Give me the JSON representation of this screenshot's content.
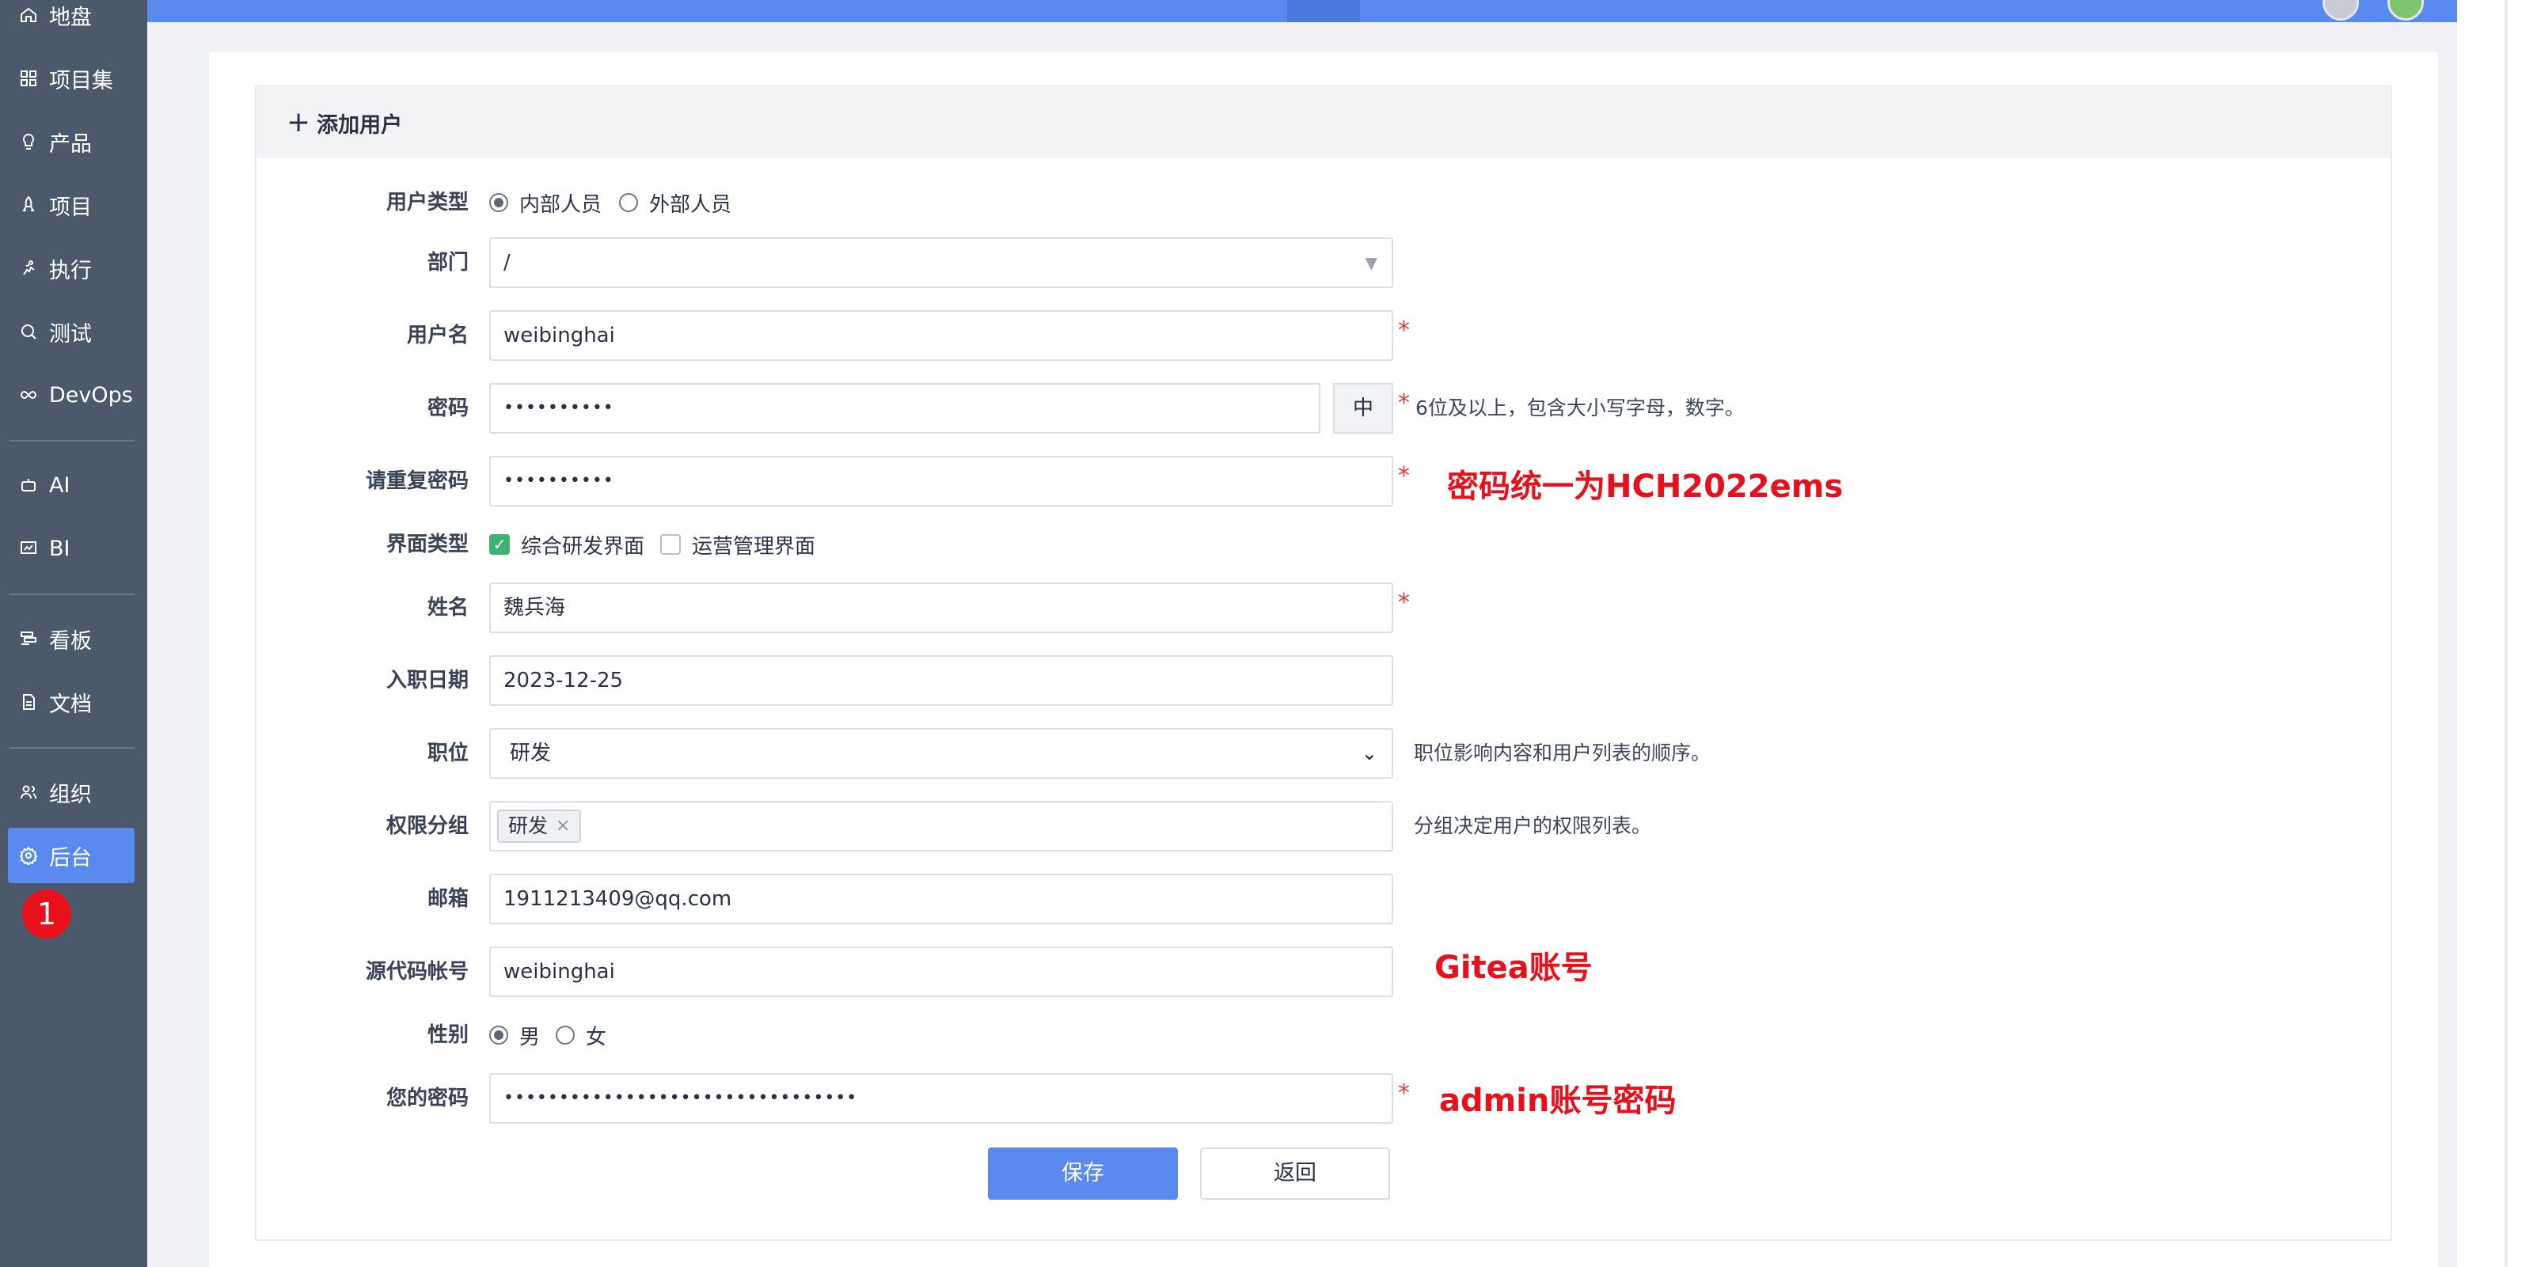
{
  "sidebar": {
    "items": [
      {
        "label": "地盘",
        "icon": "home-icon"
      },
      {
        "label": "项目集",
        "icon": "grid-icon"
      },
      {
        "label": "产品",
        "icon": "bulb-icon"
      },
      {
        "label": "项目",
        "icon": "rocket-icon"
      },
      {
        "label": "执行",
        "icon": "run-icon"
      },
      {
        "label": "测试",
        "icon": "search-icon"
      },
      {
        "label": "DevOps",
        "icon": "infinity-icon"
      },
      {
        "label": "AI",
        "icon": "robot-icon"
      },
      {
        "label": "BI",
        "icon": "chart-icon"
      },
      {
        "label": "看板",
        "icon": "board-icon"
      },
      {
        "label": "文档",
        "icon": "doc-icon"
      },
      {
        "label": "组织",
        "icon": "users-icon"
      },
      {
        "label": "后台",
        "icon": "gear-icon"
      }
    ],
    "active_item": "后台",
    "step_badge": "1"
  },
  "card": {
    "title": "添加用户",
    "title_icon": "plus-icon"
  },
  "form": {
    "user_type": {
      "label": "用户类型",
      "options": [
        "内部人员",
        "外部人员"
      ],
      "selected": "内部人员"
    },
    "dept": {
      "label": "部门",
      "value": "/"
    },
    "account": {
      "label": "用户名",
      "value": "weibinghai"
    },
    "password": {
      "label": "密码",
      "value": "••••••••••",
      "strength": "中",
      "hint": "6位及以上，包含大小写字母，数字。"
    },
    "password_repeat": {
      "label": "请重复密码",
      "value": "••••••••••"
    },
    "visions": {
      "label": "界面类型",
      "options": [
        "综合研发界面",
        "运营管理界面"
      ],
      "checked": [
        "综合研发界面"
      ]
    },
    "realname": {
      "label": "姓名",
      "value": "魏兵海"
    },
    "join_date": {
      "label": "入职日期",
      "value": "2023-12-25"
    },
    "role": {
      "label": "职位",
      "value": "研发",
      "hint": "职位影响内容和用户列表的顺序。"
    },
    "group": {
      "label": "权限分组",
      "tags": [
        "研发"
      ],
      "hint": "分组决定用户的权限列表。"
    },
    "email": {
      "label": "邮箱",
      "value": "1911213409@qq.com"
    },
    "commiter": {
      "label": "源代码帐号",
      "value": "weibinghai"
    },
    "gender": {
      "label": "性别",
      "options": [
        "男",
        "女"
      ],
      "selected": "男"
    },
    "verify_password": {
      "label": "您的密码",
      "value": "••••••••••••••••••••••••••••••••"
    }
  },
  "required_mark": "*",
  "annotations": {
    "password_note": "密码统一为HCH2022ems",
    "gitea_note": "Gitea账号",
    "admin_note": "admin账号密码"
  },
  "actions": {
    "save": "保存",
    "back": "返回"
  },
  "colors": {
    "accent": "#5a8af0",
    "sidebar": "#4b596b",
    "annotation": "#e8101a",
    "required": "#e23b3b",
    "checkbox": "#3cb371"
  }
}
